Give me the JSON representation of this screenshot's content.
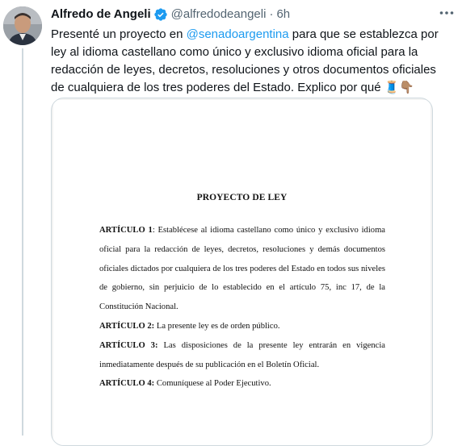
{
  "tweet": {
    "author_name": "Alfredo de Angeli",
    "handle": "@alfredodeangeli",
    "separator": "·",
    "time": "6h",
    "text_before": "Presenté un proyecto en ",
    "mention": "@senadoargentina",
    "text_after": " para que se establezca por ley al idioma castellano como único y exclusivo idioma oficial para la redacción de leyes, decretos, resoluciones y otros documentos oficiales de cualquiera de los tres poderes del Estado. Explico por qué 🧵👇🏽"
  },
  "document": {
    "title": "PROYECTO DE LEY",
    "articles": [
      {
        "label": "ARTÍCULO 1",
        "separator": ": ",
        "text": "Establécese al idioma castellano como único y exclusivo idioma oficial para la redacción de leyes, decretos, resoluciones y demás documentos oficiales dictados por cualquiera de los tres poderes del Estado en todos sus niveles de gobierno, sin perjuicio de lo establecido en el artículo 75, inc 17, de la Constitución Nacional."
      },
      {
        "label": "ARTÍCULO 2:",
        "separator": " ",
        "text": "La presente ley es de orden público."
      },
      {
        "label": "ARTÍCULO 3:",
        "separator": " ",
        "text": "Las disposiciones de la presente ley entrarán en vigencia inmediatamente después de su publicación en el Boletín Oficial."
      },
      {
        "label": "ARTÍCULO 4:",
        "separator": " ",
        "text": "Comuníquese al Poder Ejecutivo."
      }
    ]
  },
  "icons": {
    "verified": "verified-badge-icon",
    "more": "more-options-icon",
    "avatar": "profile-photo"
  },
  "colors": {
    "accent": "#1d9bf0",
    "text_primary": "#0f1419",
    "text_secondary": "#536471",
    "border": "#cfd9de"
  }
}
